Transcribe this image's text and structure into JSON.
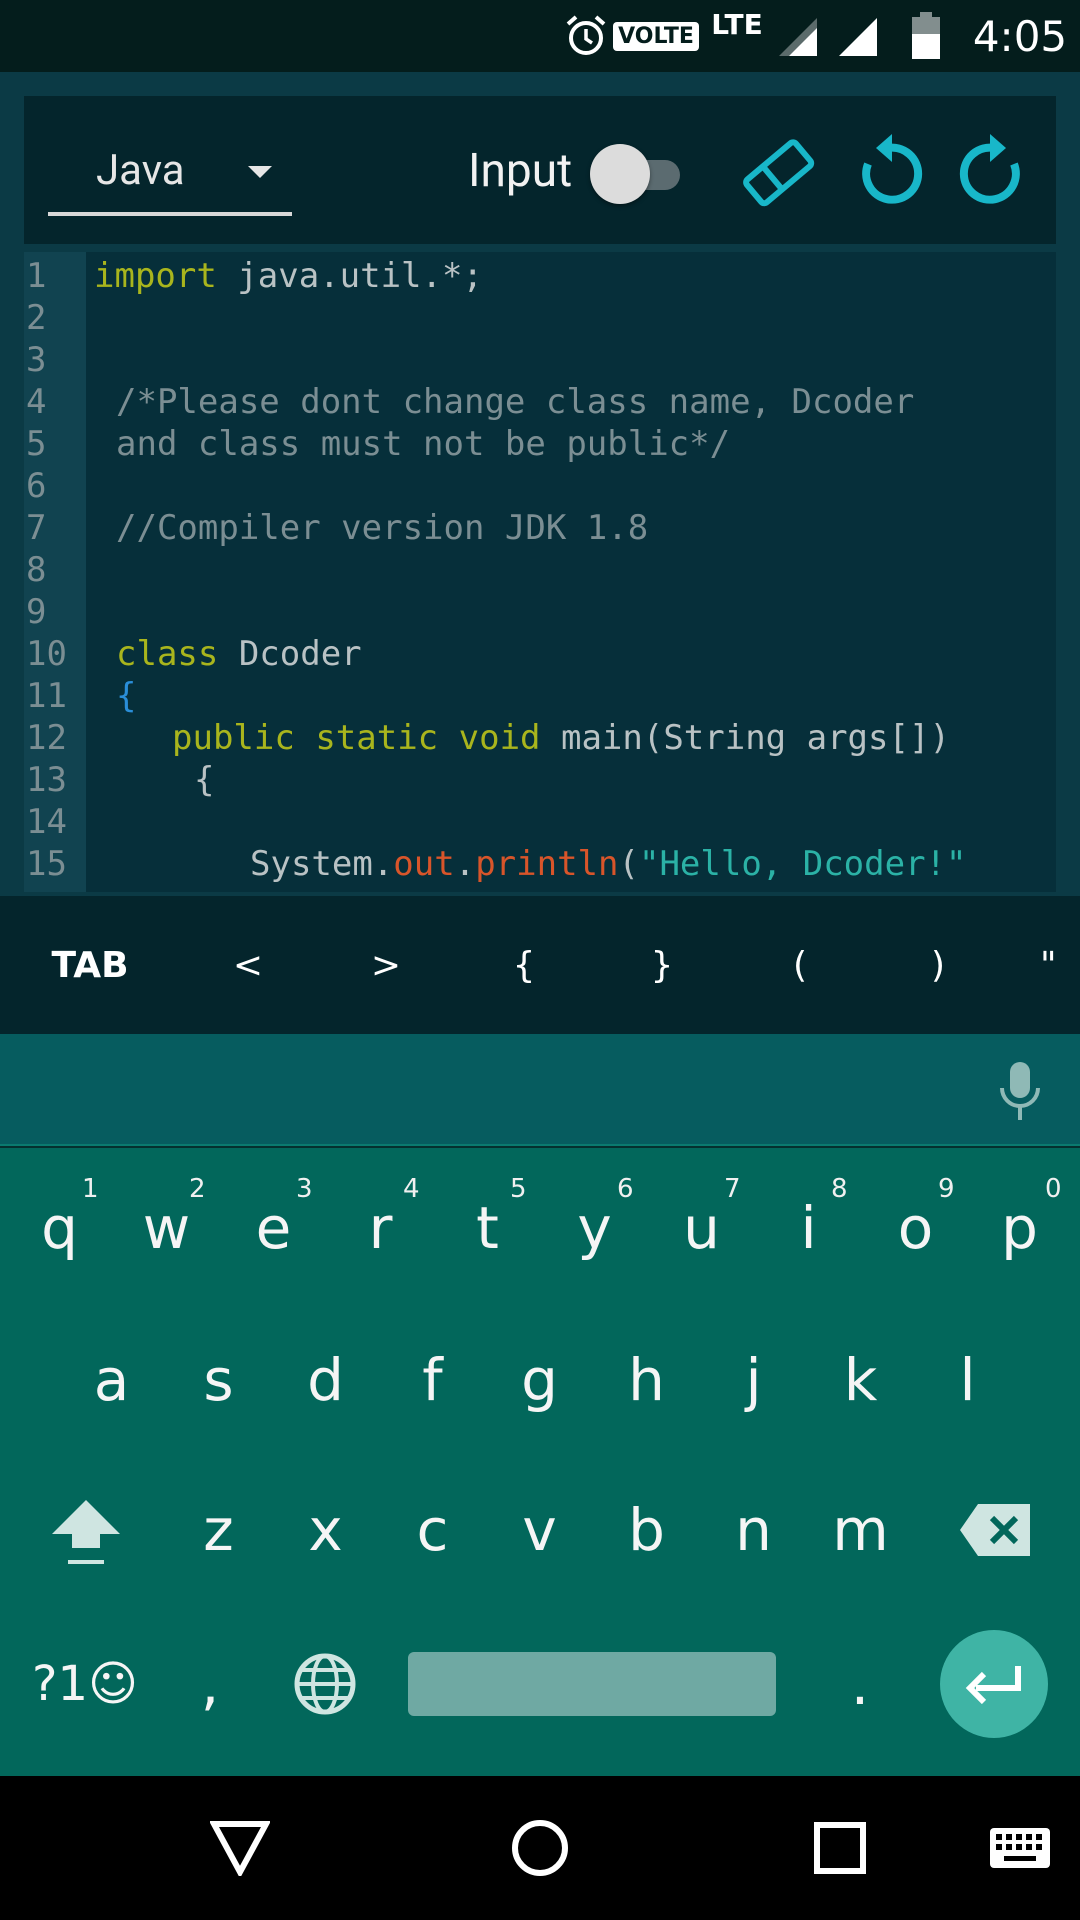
{
  "status_bar": {
    "volte": "VOLTE",
    "network": "LTE",
    "battery_level": "41",
    "time": "4:05"
  },
  "toolbar": {
    "language": "Java",
    "input_label": "Input",
    "input_enabled": false
  },
  "editor": {
    "lines": [
      {
        "n": "1",
        "text": "import java.util.*;"
      },
      {
        "n": "2",
        "text": ""
      },
      {
        "n": "3",
        "text": ""
      },
      {
        "n": "4",
        "text": "/*Please dont change class name, Dcoder"
      },
      {
        "n": "5",
        "text": "and class must not be public*/"
      },
      {
        "n": "6",
        "text": ""
      },
      {
        "n": "7",
        "text": "//Compiler version JDK 1.8"
      },
      {
        "n": "8",
        "text": ""
      },
      {
        "n": "9",
        "text": ""
      },
      {
        "n": "10",
        "text": "class Dcoder"
      },
      {
        "n": "11",
        "text": "{"
      },
      {
        "n": "12",
        "text": "public static void main(String args[])"
      },
      {
        "n": "13",
        "text": "{"
      },
      {
        "n": "14",
        "text": ""
      },
      {
        "n": "15",
        "text": "System.out.println(\"Hello, Dcoder!\""
      }
    ]
  },
  "extra_keys": [
    "TAB",
    "<",
    ">",
    "{",
    "}",
    "(",
    ")",
    "\""
  ],
  "keyboard": {
    "row1": [
      "q",
      "w",
      "e",
      "r",
      "t",
      "y",
      "u",
      "i",
      "o",
      "p"
    ],
    "row1_hints": [
      "1",
      "2",
      "3",
      "4",
      "5",
      "6",
      "7",
      "8",
      "9",
      "0"
    ],
    "row2": [
      "a",
      "s",
      "d",
      "f",
      "g",
      "h",
      "j",
      "k",
      "l"
    ],
    "row3": [
      "z",
      "x",
      "c",
      "v",
      "b",
      "n",
      "m"
    ],
    "symbols_key": "?1☺",
    "comma": ",",
    "period": "."
  },
  "colors": {
    "keyword": "#a9b51d",
    "comment": "#7b8e93",
    "accent_cyan": "#18b7c9",
    "keyboard_bg": "#02675b"
  }
}
